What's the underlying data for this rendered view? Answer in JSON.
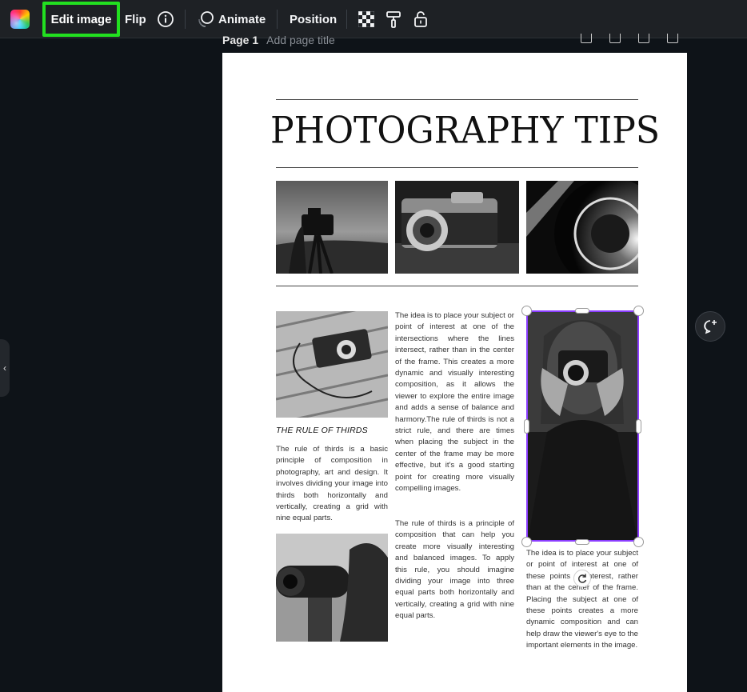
{
  "toolbar": {
    "edit_image": "Edit image",
    "flip": "Flip",
    "animate": "Animate",
    "position": "Position",
    "icons": [
      "color-picker-icon",
      "info-icon",
      "animate-icon",
      "transparency-icon",
      "paint-roller-icon",
      "lock-icon"
    ],
    "highlight_color": "#22e020"
  },
  "page": {
    "label": "Page 1",
    "title_placeholder": "Add page title"
  },
  "document": {
    "title": "PHOTOGRAPHY TIPS",
    "rule_of_thirds_heading": "THE RULE OF THIRDS",
    "left_paragraph": "The rule of thirds is a basic principle of composition in photography, art and design. It involves dividing your image into thirds both horizontally and vertically, creating a grid with nine equal parts.",
    "middle_paragraph_1": "The idea is to place your subject or point of interest at one of the intersections where the lines intersect, rather than in the center of the frame. This creates a more dynamic and visually interesting composition, as it allows the viewer to explore the entire image and adds a sense of balance and harmony.The rule of thirds is not a strict rule, and there are times when placing the subject in the center of the frame may be more effective, but it's a good starting point for creating more visually compelling images.",
    "middle_paragraph_2": "The rule of thirds is a principle of composition that can help you create more visually interesting and balanced images. To apply this rule, you should imagine dividing your image into three equal parts both horizontally and vertically, creating a grid with nine equal parts.",
    "right_paragraph": "The idea is to place your subject or point of interest at one of these points of interest, rather than at the center of the frame. Placing the subject at one of these points creates a more dynamic composition and can help draw the viewer's eye to the important elements in the image."
  },
  "selection_color": "#8b3dff"
}
